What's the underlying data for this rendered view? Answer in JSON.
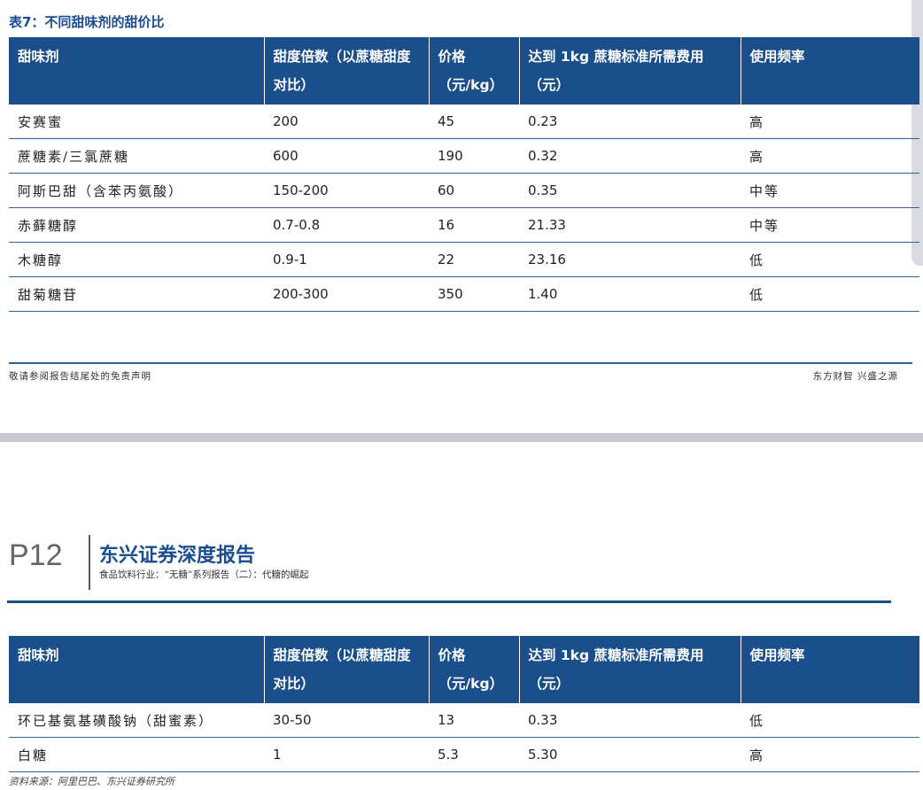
{
  "top": {
    "title": "表7：不同甜味剂的甜价比",
    "headers": [
      "甜味剂",
      "甜度倍数（以蔗糖甜度对比）",
      "价格 （元/kg）",
      "达到 1kg 蔗糖标准所需费用（元）",
      "使用频率"
    ],
    "rows": [
      [
        "安赛蜜",
        "200",
        "45",
        "0.23",
        "高"
      ],
      [
        "蔗糖素/三氯蔗糖",
        "600",
        "190",
        "0.32",
        "高"
      ],
      [
        "阿斯巴甜（含苯丙氨酸）",
        "150-200",
        "60",
        "0.35",
        "中等"
      ],
      [
        "赤藓糖醇",
        "0.7-0.8",
        "16",
        "21.33",
        "中等"
      ],
      [
        "木糖醇",
        "0.9-1",
        "22",
        "23.16",
        "低"
      ],
      [
        "甜菊糖苷",
        "200-300",
        "350",
        "1.40",
        "低"
      ]
    ],
    "footer_left": "敬请参阅报告结尾处的免责声明",
    "footer_right": "东方财智 兴盛之源"
  },
  "bottom": {
    "page_no": "P12",
    "report_title": "东兴证券深度报告",
    "report_subtitle": "食品饮料行业：“无糖”系列报告（二）：代糖的崛起",
    "headers": [
      "甜味剂",
      "甜度倍数（以蔗糖甜度对比）",
      "价格 （元/kg）",
      "达到 1kg 蔗糖标准所需费用（元）",
      "使用频率"
    ],
    "rows": [
      [
        "环已基氨基磺酸钠（甜蜜素）",
        "30-50",
        "13",
        "0.33",
        "低"
      ],
      [
        "白糖",
        "1",
        "5.3",
        "5.30",
        "高"
      ]
    ],
    "source": "资料来源：阿里巴巴、东兴证券研究所"
  }
}
